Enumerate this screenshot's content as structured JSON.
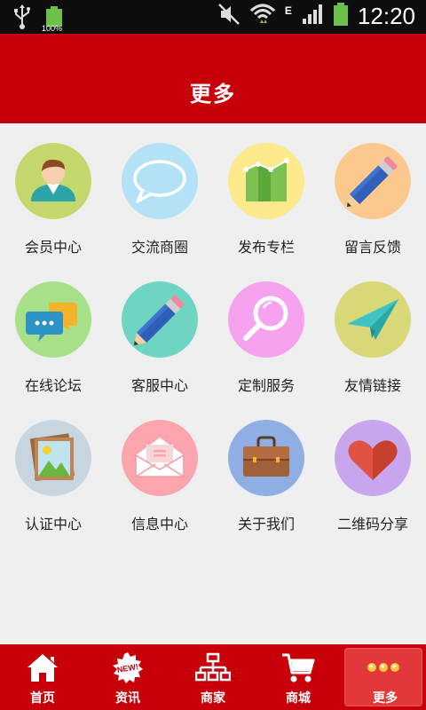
{
  "status_bar": {
    "battery_small_label": "100%",
    "time": "12:20",
    "network_type": "E",
    "icons": [
      "usb-icon",
      "battery-charging-icon",
      "mute-icon",
      "wifi-icon",
      "signal-icon",
      "battery-icon"
    ]
  },
  "header": {
    "title": "更多"
  },
  "grid": {
    "items": [
      {
        "label": "会员中心",
        "icon": "member-icon",
        "color": "#c5d86d"
      },
      {
        "label": "交流商圈",
        "icon": "chat-bubble-icon",
        "color": "#b3e1f5"
      },
      {
        "label": "发布专栏",
        "icon": "chart-icon",
        "color": "#fbe98c"
      },
      {
        "label": "留言反馈",
        "icon": "pencil-icon",
        "color": "#fbc98e"
      },
      {
        "label": "在线论坛",
        "icon": "forum-icon",
        "color": "#a8e08a"
      },
      {
        "label": "客服中心",
        "icon": "pencil-icon",
        "color": "#6fd4c2"
      },
      {
        "label": "定制服务",
        "icon": "magnifier-icon",
        "color": "#f7a2ee"
      },
      {
        "label": "友情链接",
        "icon": "paper-plane-icon",
        "color": "#d8d878"
      },
      {
        "label": "认证中心",
        "icon": "picture-icon",
        "color": "#c7d5e0"
      },
      {
        "label": "信息中心",
        "icon": "envelope-icon",
        "color": "#fba5ae"
      },
      {
        "label": "关于我们",
        "icon": "briefcase-icon",
        "color": "#8eaee4"
      },
      {
        "label": "二维码分享",
        "icon": "heart-icon",
        "color": "#c7a6ee"
      }
    ]
  },
  "bottom_nav": {
    "items": [
      {
        "label": "首页",
        "icon": "home-icon"
      },
      {
        "label": "资讯",
        "icon": "new-badge-icon",
        "badge_text": "NEW!"
      },
      {
        "label": "商家",
        "icon": "sitemap-icon"
      },
      {
        "label": "商城",
        "icon": "cart-icon"
      },
      {
        "label": "更多",
        "icon": "more-dots-icon",
        "active": true
      }
    ]
  },
  "colors": {
    "primary_red": "#c8000a",
    "active_tab": "#e2383c",
    "background": "#efefef"
  }
}
